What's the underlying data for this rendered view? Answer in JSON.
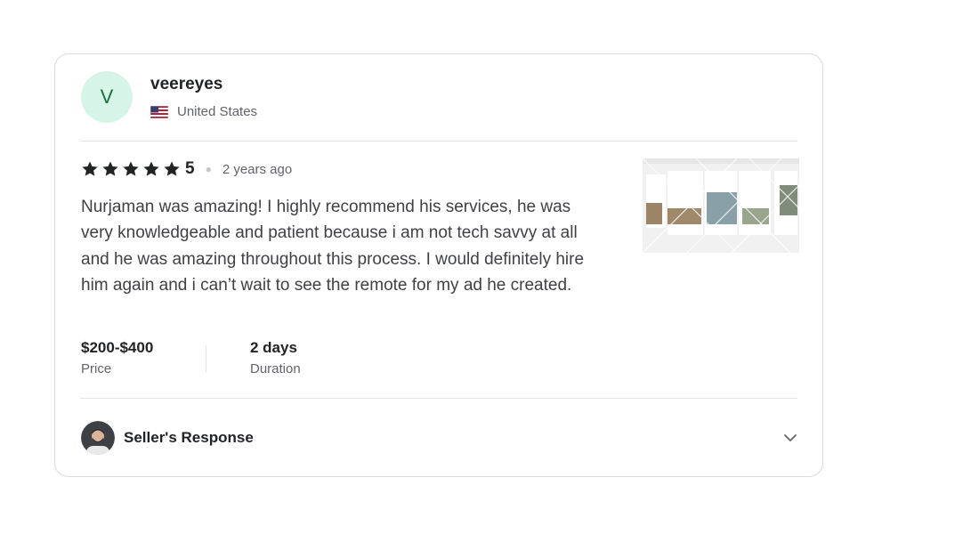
{
  "review": {
    "avatar_letter": "V",
    "username": "veereyes",
    "country": "United States",
    "rating": "5",
    "stars_filled": 5,
    "stars_total": 5,
    "time_ago": "2 years ago",
    "text": "Nurjaman was amazing! I highly recommend his services, he was very knowledgeable and patient because i am not tech savvy at all and he was amazing throughout this process. I would definitely hire him again and i can’t wait to see the remote for my ad he created.",
    "price_value": "$200-$400",
    "price_label": "Price",
    "duration_value": "2 days",
    "duration_label": "Duration",
    "seller_response_label": "Seller's Response"
  },
  "icons": {
    "flag": "us-flag-icon",
    "star": "star-icon",
    "chevron": "chevron-down-icon"
  },
  "colors": {
    "avatar_bg": "#d6f5e6",
    "avatar_text": "#1f6e44",
    "star": "#222325",
    "border": "#dadbdd",
    "muted_text": "#62646a"
  }
}
